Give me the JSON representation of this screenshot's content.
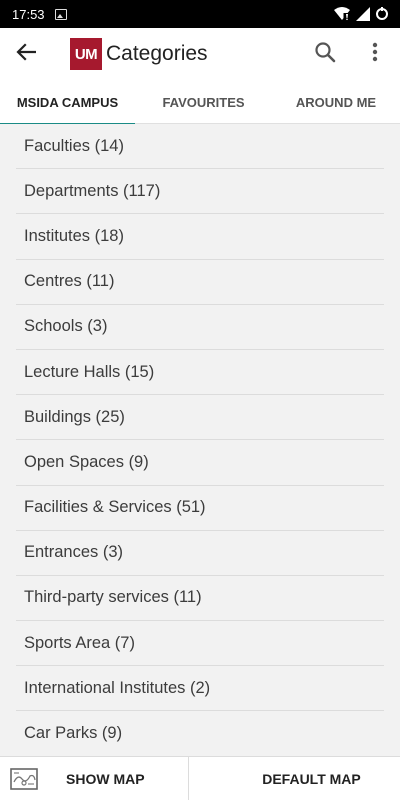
{
  "status_bar": {
    "time": "17:53",
    "icons": [
      "image-icon",
      "wifi-icon",
      "signal-icon",
      "battery-icon"
    ]
  },
  "app_bar": {
    "logo_text": "UM",
    "title": "Categories",
    "logo_color": "#a6192e",
    "icons": [
      "back-arrow-icon",
      "search-icon",
      "more-vert-icon"
    ]
  },
  "tabs": [
    {
      "label": "MSIDA CAMPUS",
      "selected": true
    },
    {
      "label": "FAVOURITES",
      "selected": false
    },
    {
      "label": "AROUND ME",
      "selected": false
    }
  ],
  "accent_color": "#1a8b86",
  "categories": [
    "Faculties (14)",
    "Departments (117)",
    "Institutes (18)",
    "Centres (11)",
    "Schools (3)",
    "Lecture Halls (15)",
    "Buildings (25)",
    "Open Spaces (9)",
    "Facilities & Services (51)",
    "Entrances (3)",
    "Third-party services (11)",
    "Sports Area (7)",
    "International Institutes (2)",
    "Car Parks (9)"
  ],
  "bottom_bar": {
    "show_map_label": "SHOW MAP",
    "default_map_label": "DEFAULT MAP",
    "map_icon": "map-icon"
  }
}
